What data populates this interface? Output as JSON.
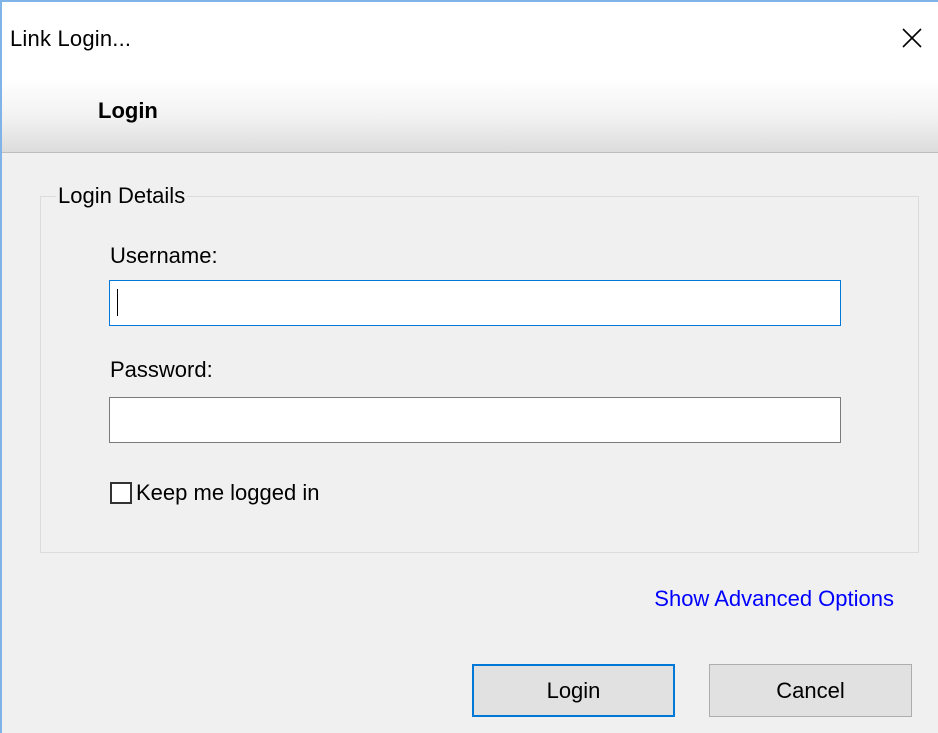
{
  "window": {
    "title": "Link Login..."
  },
  "banner": {
    "title": "Login"
  },
  "login_details": {
    "legend": "Login Details",
    "username_label": "Username:",
    "username_value": "",
    "password_label": "Password:",
    "password_value": "",
    "keep_logged_in_label": "Keep me logged in",
    "keep_logged_in_checked": false
  },
  "advanced_link": "Show Advanced Options",
  "buttons": {
    "login_label": "Login",
    "cancel_label": "Cancel"
  },
  "icons": {
    "close": "close-icon"
  },
  "colors": {
    "focus_border": "#0078d7",
    "link": "#0000ff",
    "window_border": "#7eb4e6",
    "dialog_background": "#f0f0f0"
  }
}
